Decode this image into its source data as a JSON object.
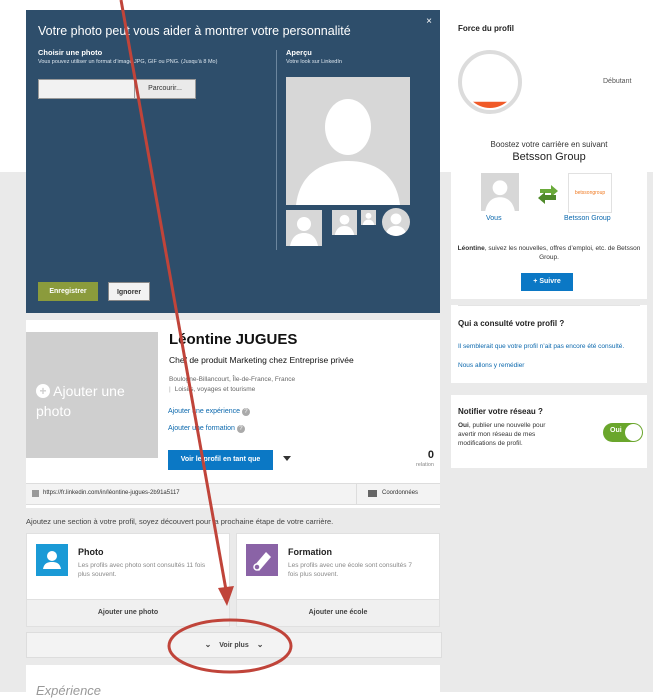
{
  "modal": {
    "title": "Votre photo peut vous aider à montrer votre personnalité",
    "close": "×",
    "choose_label": "Choisir une photo",
    "choose_hint": "Vous pouvez utiliser un format d’image JPG, GIF ou PNG. (Jusqu’à 8 Mo)",
    "browse_label": "Parcourir...",
    "preview_label": "Aperçu",
    "preview_hint": "Votre look sur LinkedIn",
    "save_label": "Enregistrer",
    "ignore_label": "Ignorer"
  },
  "profile_strength": {
    "title": "Force du profil",
    "level": "Débutant",
    "fill_fraction": 0.12,
    "fill_color": "#f05a28"
  },
  "follow": {
    "intro": "Boostez votre carrière en suivant",
    "company": "Betsson Group",
    "you_label": "Vous",
    "company_label": "Betsson Group",
    "logo_text": "betssongroup",
    "text_name": "Léontine",
    "text_rest": ", suivez les nouvelles, offres d’emploi, etc. de Betsson Group.",
    "follow_button": "+ Suivre"
  },
  "viewers": {
    "title": "Qui a consulté votre profil ?",
    "line1": "Il semblerait que votre profil n’ait pas encore été consulté.",
    "line2": "Nous allons y remédier"
  },
  "notify": {
    "title": "Notifier votre réseau ?",
    "bold": "Oui",
    "text": ", publier une nouvelle pour avertir mon réseau de mes modifications de profil.",
    "toggle_label": "Oui"
  },
  "profile": {
    "add_photo": "Ajouter une photo",
    "name": "Léontine JUGUES",
    "headline": "Chef de produit Marketing chez Entreprise privée",
    "location": "Boulogne-Billancourt, Île-de-France, France",
    "industry": "Loisirs, voyages et tourisme",
    "add_experience": "Ajouter une expérience",
    "add_education": "Ajouter une formation",
    "view_as": "Voir le profil en tant que",
    "connections_count": "0",
    "connections_label": "relation",
    "url": "https://fr.linkedin.com/in/léontine-jugues-2b91a5117",
    "contact_label": "Coordonnées"
  },
  "sections": {
    "prompt": "Ajoutez une section à votre profil, soyez découvert pour la prochaine étape de votre carrière.",
    "cards": [
      {
        "title": "Photo",
        "desc": "Les profils avec photo sont consultés 11 fois plus souvent.",
        "action": "Ajouter une photo",
        "color": "#1a9ad6"
      },
      {
        "title": "Formation",
        "desc": "Les profils avec une école sont consultés 7 fois plus souvent.",
        "action": "Ajouter une école",
        "color": "#8a63a6"
      }
    ],
    "more_label": "Voir plus",
    "next_title": "Expérience"
  },
  "annotation": {
    "color": "#c0443a"
  }
}
